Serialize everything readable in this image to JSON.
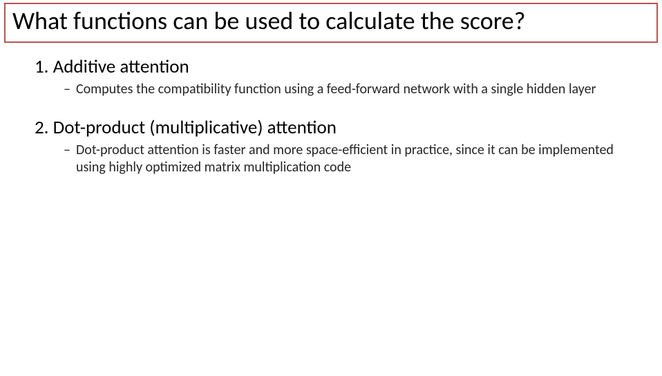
{
  "title": "What functions can be used to calculate the score?",
  "items": [
    {
      "num": "1.",
      "heading": "Additive attention",
      "sub": "Computes the compatibility function using a feed-forward network with a single hidden layer"
    },
    {
      "num": "2.",
      "heading": "Dot-product (multiplicative) attention",
      "sub": "Dot-product attention is faster and more space-efficient in practice, since it can be implemented using highly optimized matrix multiplication code"
    }
  ],
  "dash": "–"
}
